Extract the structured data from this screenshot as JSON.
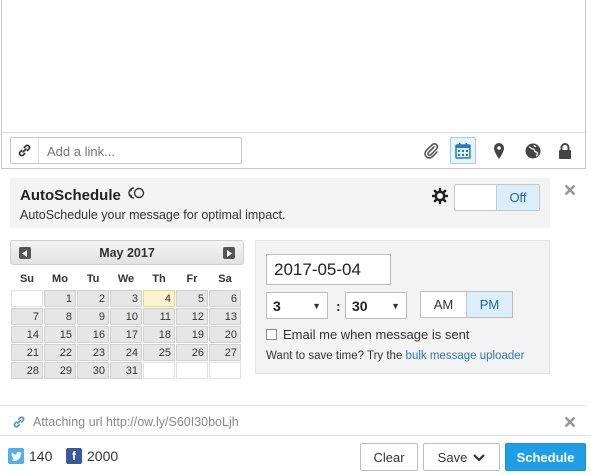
{
  "composer": {
    "link_placeholder": "Add a link..."
  },
  "toolbar_icons": [
    "paperclip-icon",
    "calendar-icon",
    "location-pin-icon",
    "globe-icon",
    "lock-icon"
  ],
  "autoschedule": {
    "title": "AutoSchedule",
    "description": "AutoSchedule your message for optimal impact.",
    "toggle_label": "Off"
  },
  "calendar": {
    "month_label": "May 2017",
    "weekdays": [
      "Su",
      "Mo",
      "Tu",
      "We",
      "Th",
      "Fr",
      "Sa"
    ],
    "weeks": [
      [
        "",
        "1",
        "2",
        "3",
        "4",
        "5",
        "6"
      ],
      [
        "7",
        "8",
        "9",
        "10",
        "11",
        "12",
        "13"
      ],
      [
        "14",
        "15",
        "16",
        "17",
        "18",
        "19",
        "20"
      ],
      [
        "21",
        "22",
        "23",
        "24",
        "25",
        "26",
        "27"
      ],
      [
        "28",
        "29",
        "30",
        "31",
        "",
        "",
        ""
      ]
    ],
    "selected_day": "4"
  },
  "time": {
    "date_value": "2017-05-04",
    "hour": "3",
    "minute": "30",
    "am_label": "AM",
    "pm_label": "PM",
    "selected_period": "PM",
    "email_label": "Email me when message is sent",
    "bulk_prefix": "Want to save time? Try the ",
    "bulk_link": "bulk message uploader"
  },
  "attach": {
    "text": "Attaching url  http://ow.ly/S60I30boLjh"
  },
  "footer": {
    "twitter_count": "140",
    "facebook_count": "2000",
    "clear_label": "Clear",
    "save_label": "Save",
    "schedule_label": "Schedule"
  },
  "colors": {
    "accent": "#1d9ee6",
    "twitter": "#55acee",
    "facebook": "#3b5998"
  }
}
